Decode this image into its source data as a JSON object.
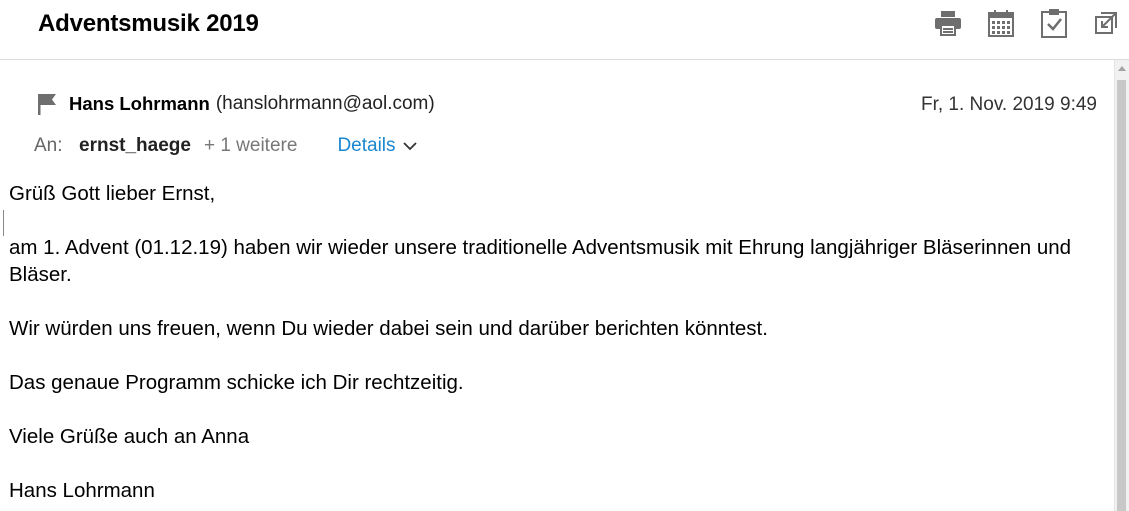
{
  "header": {
    "subject": "Adventsmusik 2019",
    "toolbar": [
      {
        "name": "print-icon"
      },
      {
        "name": "calendar-icon"
      },
      {
        "name": "task-clipboard-icon"
      },
      {
        "name": "popout-icon"
      }
    ]
  },
  "message": {
    "sender_name": "Hans Lohrmann",
    "sender_email": "(hanslohrmann@aol.com)",
    "date": "Fr, 1. Nov. 2019 9:49",
    "to_label": "An:",
    "to_recipient": "ernst_haege",
    "to_more": "+ 1 weitere",
    "details_label": "Details"
  },
  "body": {
    "p1": "Grüß Gott lieber Ernst,",
    "p2": "am 1. Advent (01.12.19) haben wir wieder unsere traditionelle Adventsmusik mit Ehrung langjähriger Bläserinnen und Bläser.",
    "p3": "Wir würden uns freuen, wenn Du wieder dabei sein und darüber berichten könntest.",
    "p4": "Das genaue Programm schicke ich Dir rechtzeitig.",
    "p5": "Viele Grüße auch an Anna",
    "p6": "Hans Lohrmann"
  },
  "colors": {
    "link": "#1a87d0",
    "icon": "#6e6e6e"
  }
}
